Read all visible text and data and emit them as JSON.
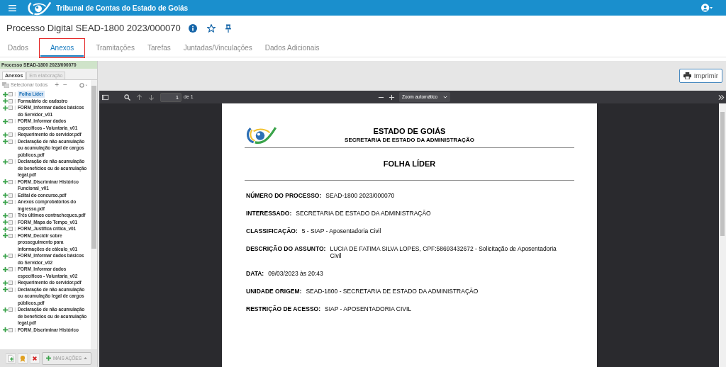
{
  "app_bar": {
    "title": "Tribunal de Contas do Estado de Goiás"
  },
  "page": {
    "title": "Processo Digital SEAD-1800 2023/000070",
    "favorite": false
  },
  "tabs": [
    {
      "label": "Dados",
      "selected": false,
      "highlighted": false
    },
    {
      "label": "Anexos",
      "selected": true,
      "highlighted": true
    },
    {
      "label": "Tramitações",
      "selected": false,
      "highlighted": false
    },
    {
      "label": "Tarefas",
      "selected": false,
      "highlighted": false
    },
    {
      "label": "Juntadas/Vinculações",
      "selected": false,
      "highlighted": false
    },
    {
      "label": "Dados Adicionais",
      "selected": false,
      "highlighted": false
    }
  ],
  "sidebar": {
    "header": "Processo SEAD-1800 2023/000070",
    "tabs": [
      {
        "label": "Anexos",
        "selected": true
      },
      {
        "label": "Em elaboração",
        "selected": false
      }
    ],
    "select_all": "Selecionar todos",
    "add_symbol": "+",
    "remove_symbol": "−",
    "items": [
      {
        "label": "Folha Líder",
        "selected": true,
        "checked": false
      },
      {
        "label": "Formulário de cadastro",
        "selected": false,
        "checked": false
      },
      {
        "label": "FORM_Informar dados básicos do Servidor_v01",
        "selected": false,
        "checked": false
      },
      {
        "label": "FORM_Informar dados específicos - Voluntaria_v01",
        "selected": false,
        "checked": false
      },
      {
        "label": "Requerimento do servidor.pdf",
        "selected": false,
        "checked": false
      },
      {
        "label": "Declaração de não acumulação ou acumulação legal de cargos públicos.pdf",
        "selected": false,
        "checked": false
      },
      {
        "label": "Declaração de não acumulação de benefícios ou de acumulação legal.pdf",
        "selected": false,
        "checked": false
      },
      {
        "label": "FORM_Discriminar Histórico Funcional_v01",
        "selected": false,
        "checked": false
      },
      {
        "label": "Edital do concurso.pdf",
        "selected": false,
        "checked": false
      },
      {
        "label": "Anexos comprobatórios do ingresso.pdf",
        "selected": false,
        "checked": false
      },
      {
        "label": "Três últimos contracheques.pdf",
        "selected": false,
        "checked": false
      },
      {
        "label": "FORM_Mapa do Tempo_v01",
        "selected": false,
        "checked": false
      },
      {
        "label": "FORM_Justifica crítica_v01",
        "selected": false,
        "checked": false
      },
      {
        "label": "FORM_Decidir sobre prosseguimento para informações de cálculo_v01",
        "selected": false,
        "checked": false
      },
      {
        "label": "FORM_Informar dados básicos do Servidor_v02",
        "selected": false,
        "checked": false
      },
      {
        "label": "FORM_Informar dados específicos - Voluntaria_v02",
        "selected": false,
        "checked": false
      },
      {
        "label": "Requerimento do servidor.pdf",
        "selected": false,
        "checked": false
      },
      {
        "label": "Declaração de não acumulação ou acumulação legal de cargos públicos.pdf",
        "selected": false,
        "checked": false
      },
      {
        "label": "Declaração de não acumulação de benefícios ou de acumulação legal.pdf",
        "selected": false,
        "checked": false
      },
      {
        "label": "FORM_Discriminar Histórico",
        "selected": false,
        "checked": false
      }
    ],
    "more_actions": "MAIS AÇÕES"
  },
  "print_button": "Imprimir",
  "pdf_toolbar": {
    "page": "1",
    "page_total": "de 1",
    "zoom": "Zoom automático"
  },
  "document": {
    "org": "ESTADO DE GOIÁS",
    "department": "SECRETARIA DE ESTADO DA ADMINISTRAÇÃO",
    "title": "FOLHA LÍDER",
    "fields": [
      {
        "label": "NÚMERO DO PROCESSO:",
        "value": "SEAD-1800 2023/000070"
      },
      {
        "label": "INTERESSADO:",
        "value": "SECRETARIA DE ESTADO DA ADMINISTRAÇÃO"
      },
      {
        "label": "CLASSIFICAÇÃO:",
        "value": "5 - SIAP - Aposentadoria Civil"
      },
      {
        "label": "DESCRIÇÃO DO ASSUNTO:",
        "value": "LUCIA DE FATIMA SILVA LOPES, CPF:58693432672 - Solicitação de Aposentadoria Civil"
      },
      {
        "label": "DATA:",
        "value": "09/03/2023 às 20:43"
      },
      {
        "label": "UNIDADE ORIGEM:",
        "value": "SEAD-1800 - SECRETARIA DE ESTADO DA ADMINISTRAÇÃO"
      },
      {
        "label": "RESTRIÇÃO DE ACESSO:",
        "value": "SIAP - APOSENTADORIA CIVIL"
      }
    ]
  }
}
